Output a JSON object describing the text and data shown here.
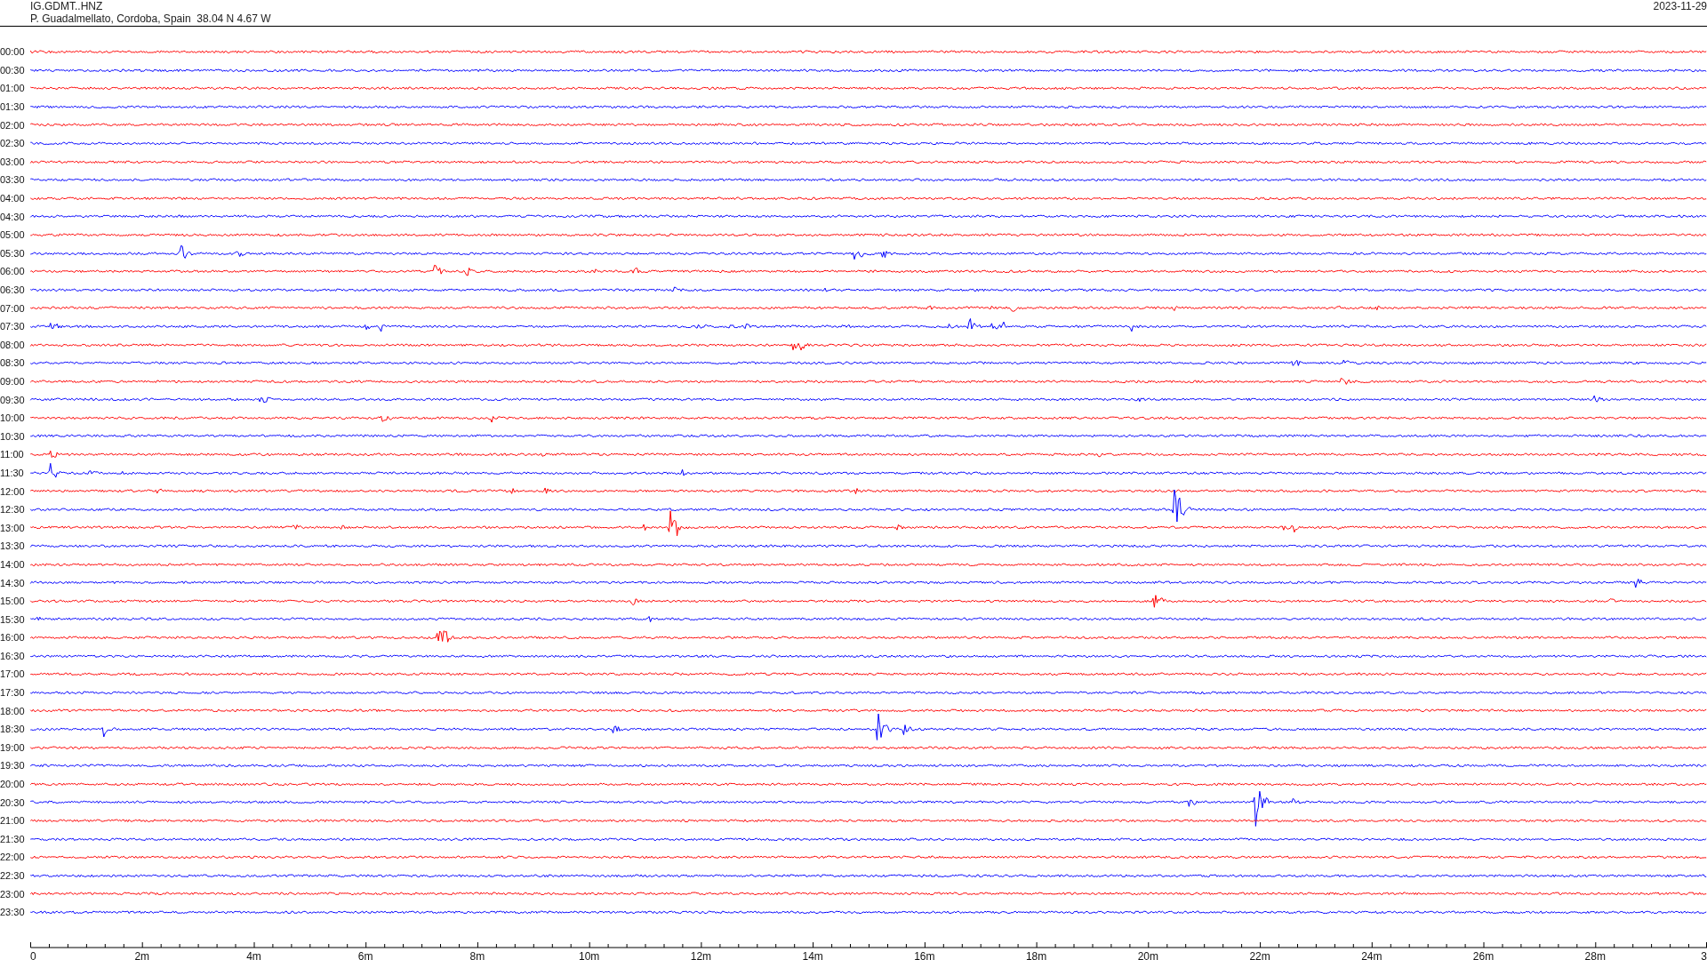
{
  "header": {
    "station": "IG.GDMT..HNZ",
    "location": "P. Guadalmellato, Cordoba, Spain  38.04 N 4.67 W",
    "date": "2023-11-29"
  },
  "helicorder": {
    "rows": [
      {
        "time": "00:00",
        "color": "#ff0000"
      },
      {
        "time": "00:30",
        "color": "#0000ff"
      },
      {
        "time": "01:00",
        "color": "#ff0000"
      },
      {
        "time": "01:30",
        "color": "#0000ff"
      },
      {
        "time": "02:00",
        "color": "#ff0000"
      },
      {
        "time": "02:30",
        "color": "#0000ff"
      },
      {
        "time": "03:00",
        "color": "#ff0000"
      },
      {
        "time": "03:30",
        "color": "#0000ff"
      },
      {
        "time": "04:00",
        "color": "#ff0000"
      },
      {
        "time": "04:30",
        "color": "#0000ff"
      },
      {
        "time": "05:00",
        "color": "#ff0000"
      },
      {
        "time": "05:30",
        "color": "#0000ff"
      },
      {
        "time": "06:00",
        "color": "#ff0000"
      },
      {
        "time": "06:30",
        "color": "#0000ff"
      },
      {
        "time": "07:00",
        "color": "#ff0000"
      },
      {
        "time": "07:30",
        "color": "#0000ff"
      },
      {
        "time": "08:00",
        "color": "#ff0000"
      },
      {
        "time": "08:30",
        "color": "#0000ff"
      },
      {
        "time": "09:00",
        "color": "#ff0000"
      },
      {
        "time": "09:30",
        "color": "#0000ff"
      },
      {
        "time": "10:00",
        "color": "#ff0000"
      },
      {
        "time": "10:30",
        "color": "#0000ff"
      },
      {
        "time": "11:00",
        "color": "#ff0000"
      },
      {
        "time": "11:30",
        "color": "#0000ff"
      },
      {
        "time": "12:00",
        "color": "#ff0000"
      },
      {
        "time": "12:30",
        "color": "#0000ff"
      },
      {
        "time": "13:00",
        "color": "#ff0000"
      },
      {
        "time": "13:30",
        "color": "#0000ff"
      },
      {
        "time": "14:00",
        "color": "#ff0000"
      },
      {
        "time": "14:30",
        "color": "#0000ff"
      },
      {
        "time": "15:00",
        "color": "#ff0000"
      },
      {
        "time": "15:30",
        "color": "#0000ff"
      },
      {
        "time": "16:00",
        "color": "#ff0000"
      },
      {
        "time": "16:30",
        "color": "#0000ff"
      },
      {
        "time": "17:00",
        "color": "#ff0000"
      },
      {
        "time": "17:30",
        "color": "#0000ff"
      },
      {
        "time": "18:00",
        "color": "#ff0000"
      },
      {
        "time": "18:30",
        "color": "#0000ff"
      },
      {
        "time": "19:00",
        "color": "#ff0000"
      },
      {
        "time": "19:30",
        "color": "#0000ff"
      },
      {
        "time": "20:00",
        "color": "#ff0000"
      },
      {
        "time": "20:30",
        "color": "#0000ff"
      },
      {
        "time": "21:00",
        "color": "#ff0000"
      },
      {
        "time": "21:30",
        "color": "#0000ff"
      },
      {
        "time": "22:00",
        "color": "#ff0000"
      },
      {
        "time": "22:30",
        "color": "#0000ff"
      },
      {
        "time": "23:00",
        "color": "#ff0000"
      },
      {
        "time": "23:30",
        "color": "#0000ff"
      }
    ],
    "x_axis_labels": [
      "0",
      "2m",
      "4m",
      "6m",
      "8m",
      "10m",
      "12m",
      "14m",
      "16m",
      "18m",
      "20m",
      "22m",
      "24m",
      "26m",
      "28m",
      "3"
    ]
  }
}
